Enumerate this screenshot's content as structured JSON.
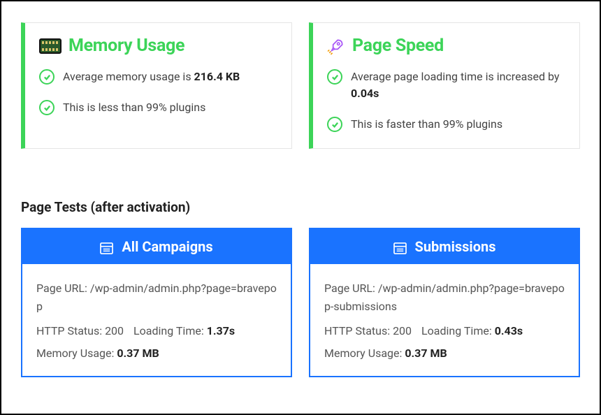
{
  "metrics": {
    "memory": {
      "title": "Memory Usage",
      "line1_prefix": "Average memory usage is ",
      "line1_value": "216.4 KB",
      "line2": "This is less than 99% plugins"
    },
    "speed": {
      "title": "Page Speed",
      "line1_prefix": "Average page loading time is increased by ",
      "line1_value": "0.04s",
      "line2": "This is faster than 99% plugins"
    }
  },
  "section_title": "Page Tests (after activation)",
  "tests": {
    "campaigns": {
      "title": "All Campaigns",
      "url_label": "Page URL: ",
      "url": "/wp-admin/admin.php?page=bravepop",
      "http_label": "HTTP Status: ",
      "http_value": "200",
      "loading_label": "Loading Time: ",
      "loading_value": "1.37s",
      "memory_label": "Memory Usage: ",
      "memory_value": "0.37 MB"
    },
    "submissions": {
      "title": "Submissions",
      "url_label": "Page URL: ",
      "url": "/wp-admin/admin.php?page=bravepop-submissions",
      "http_label": "HTTP Status: ",
      "http_value": "200",
      "loading_label": "Loading Time: ",
      "loading_value": "0.43s",
      "memory_label": "Memory Usage: ",
      "memory_value": "0.37 MB"
    }
  }
}
